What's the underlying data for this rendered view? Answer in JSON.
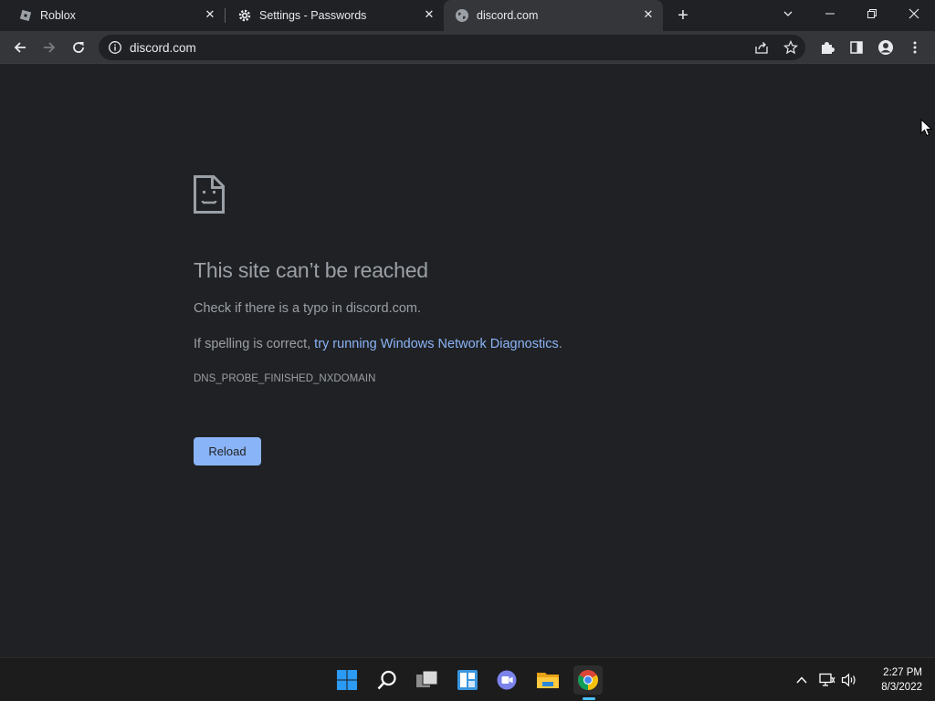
{
  "tabs": [
    {
      "title": "Roblox",
      "close": "✕"
    },
    {
      "title": "Settings - Passwords",
      "close": "✕"
    },
    {
      "title": "discord.com",
      "close": "✕"
    }
  ],
  "new_tab": "+",
  "window_controls": {
    "dropdown": "⌄",
    "minimize": "—",
    "restore": "❐",
    "close": "✕"
  },
  "omnibox": {
    "url": "discord.com"
  },
  "error": {
    "title": "This site can’t be reached",
    "line1": "Check if there is a typo in discord.com.",
    "line2_prefix": "If spelling is correct, ",
    "line2_link": "try running Windows Network Diagnostics",
    "line2_suffix": ".",
    "code": "DNS_PROBE_FINISHED_NXDOMAIN",
    "reload_label": "Reload"
  },
  "taskbar": {
    "apps": [
      "start-icon",
      "search-icon",
      "task-view-icon",
      "widgets-icon",
      "teams-chat-icon",
      "file-explorer-icon",
      "chrome-icon"
    ],
    "clock_time": "2:27 PM",
    "clock_date": "8/3/2022"
  },
  "colors": {
    "accent": "#8ab4f8",
    "background": "#202124",
    "toolbar": "#35363a",
    "taskbar": "#1c1c1c"
  }
}
